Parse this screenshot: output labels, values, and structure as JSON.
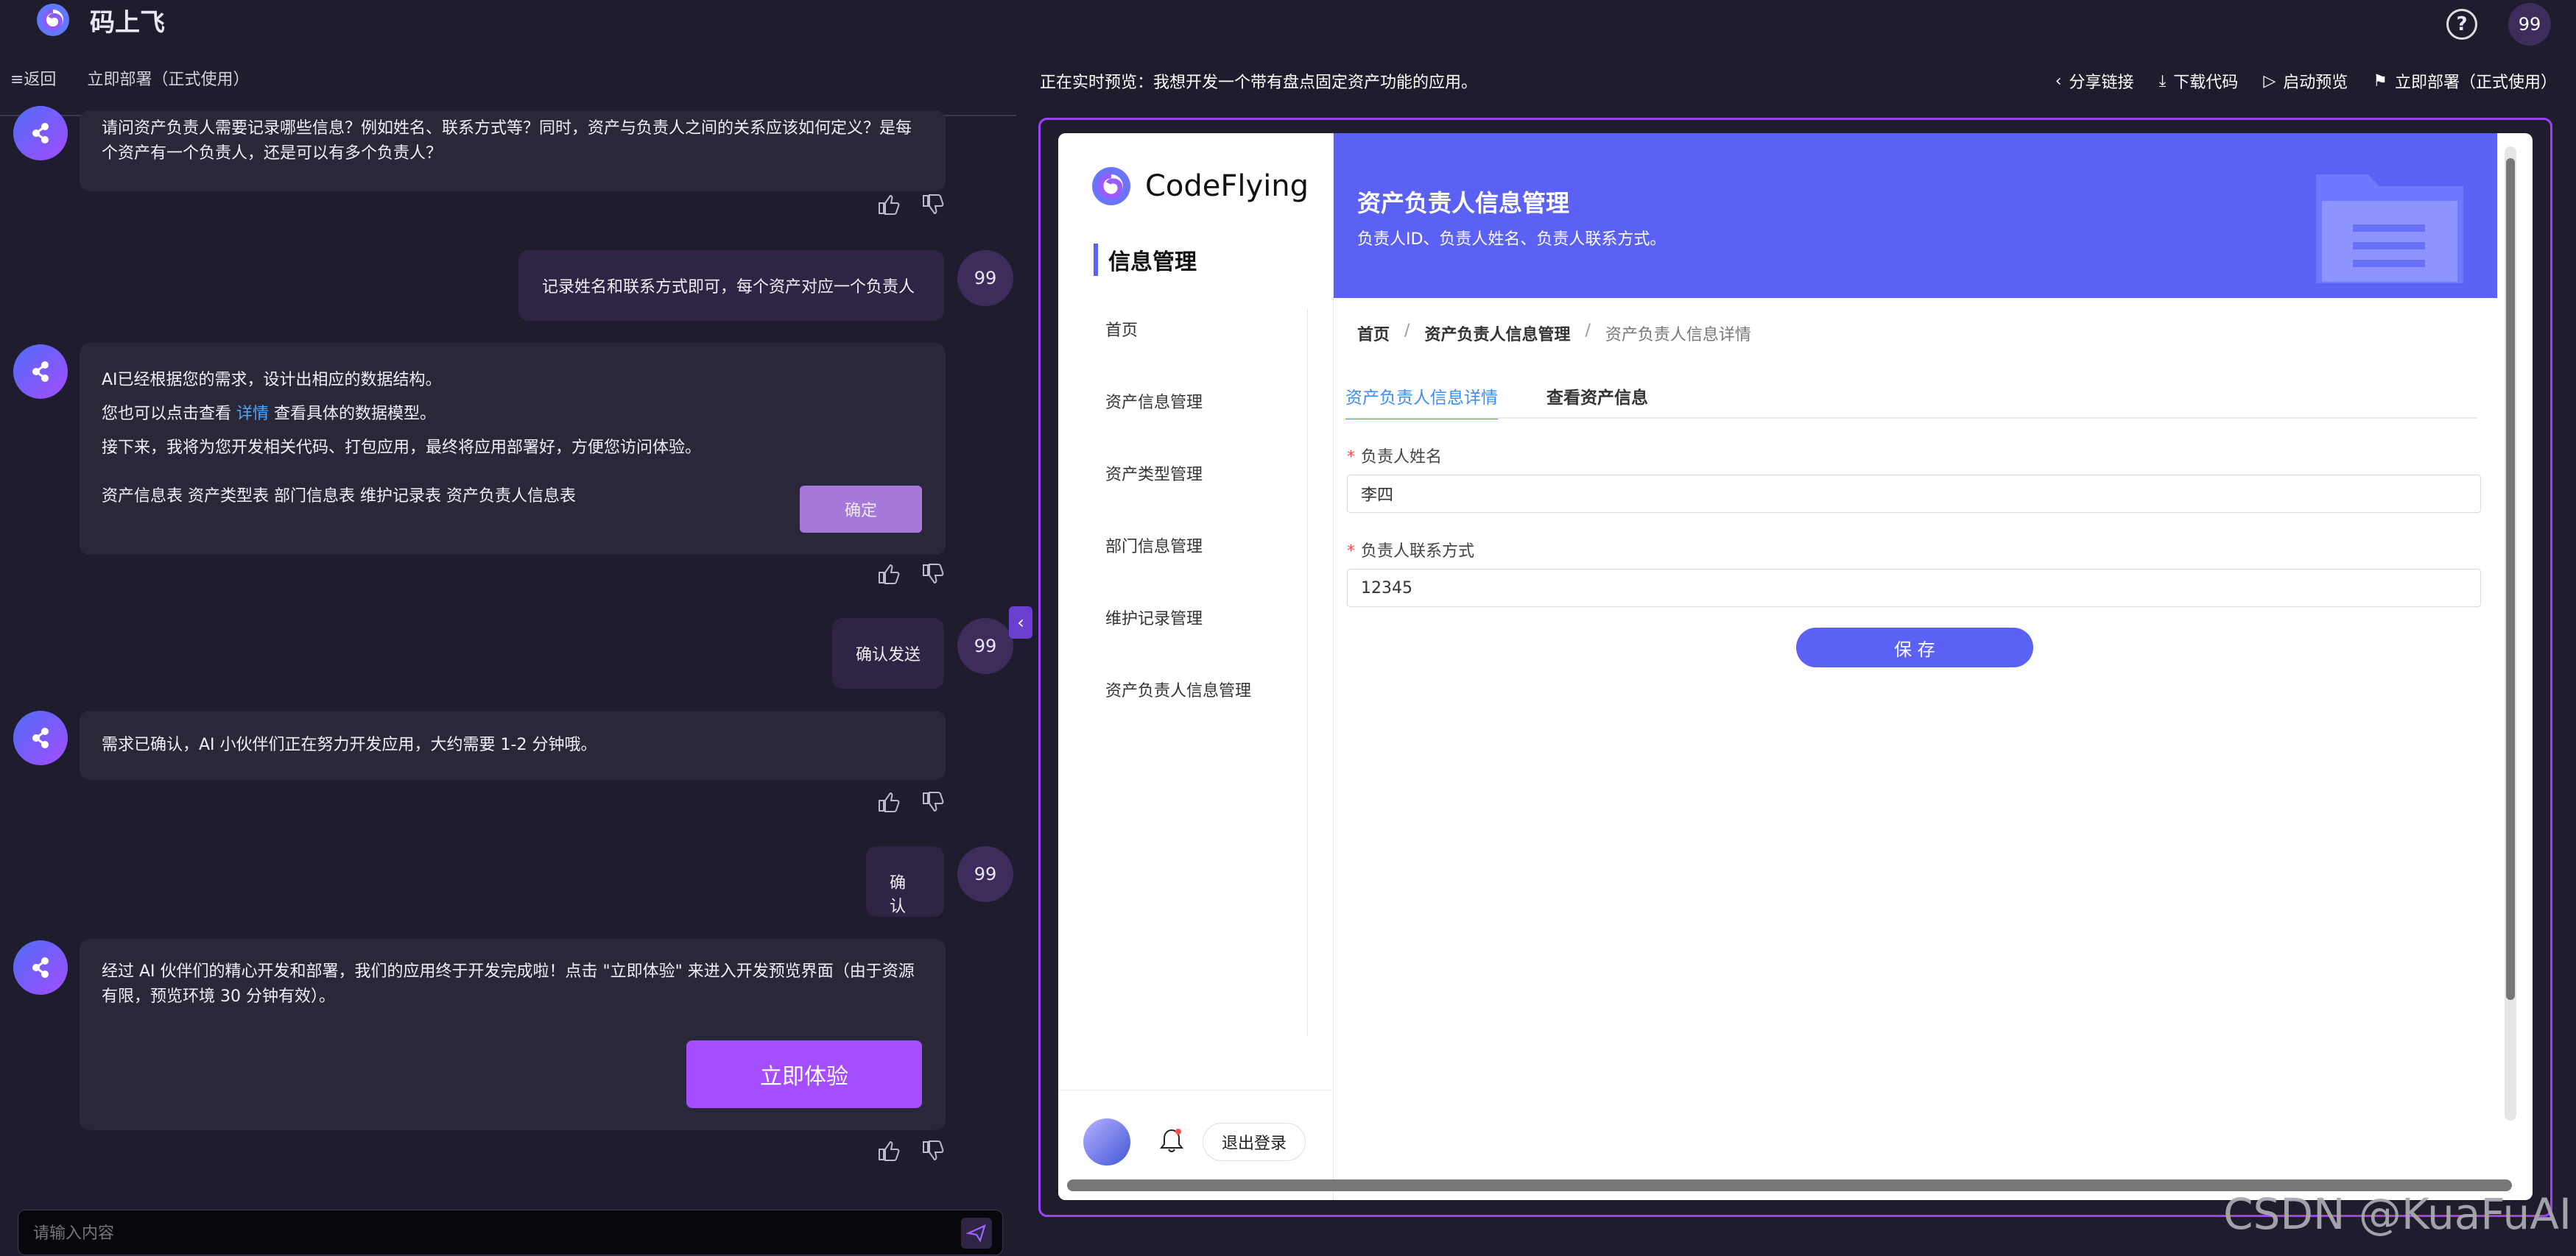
{
  "app": {
    "title": "码上飞",
    "avatar": "99",
    "help": "?"
  },
  "left_toolbar": {
    "back": "≡返回",
    "deploy": "立即部署（正式使用）"
  },
  "messages": [
    {
      "role": "bot",
      "text": "请问资产负责人需要记录哪些信息？例如姓名、联系方式等？同时，资产与负责人之间的关系应该如何定义？是每个资产有一个负责人，还是可以有多个负责人？"
    },
    {
      "role": "user",
      "text": "记录姓名和联系方式即可，每个资产对应一个负责人",
      "avatar": "99"
    },
    {
      "role": "bot",
      "lines": [
        "AI已经根据您的需求，设计出相应的数据结构。",
        "您也可以点击查看",
        "详情",
        "查看具体的数据模型。",
        "接下来，我将为您开发相关代码、打包应用，最终将应用部署好，方便您访问体验。",
        "资产信息表 资产类型表 部门信息表 维护记录表 资产负责人信息表"
      ],
      "button": "确定"
    },
    {
      "role": "user",
      "text": "确认发送",
      "avatar": "99"
    },
    {
      "role": "bot",
      "text": "需求已确认，AI 小伙伴们正在努力开发应用，大约需要 1-2 分钟哦。"
    },
    {
      "role": "user",
      "text": "确认",
      "avatar": "99"
    },
    {
      "role": "bot",
      "text": "经过 AI 伙伴们的精心开发和部署，我们的应用终于开发完成啦！点击 \"立即体验\" 来进入开发预览界面（由于资源有限，预览环境 30 分钟有效）。",
      "button": "立即体验"
    }
  ],
  "input": {
    "placeholder": "请输入内容"
  },
  "preview": {
    "status": "正在实时预览：我想开发一个带有盘点固定资产功能的应用。",
    "actions": [
      "分享链接",
      "下载代码",
      "启动预览",
      "立即部署（正式使用）"
    ],
    "brand": "CodeFlying",
    "section": "信息管理",
    "menu": [
      "首页",
      "资产信息管理",
      "资产类型管理",
      "部门信息管理",
      "维护记录管理",
      "资产负责人信息管理"
    ],
    "logout": "退出登录",
    "banner": {
      "title": "资产负责人信息管理",
      "subtitle": "负责人ID、负责人姓名、负责人联系方式。"
    },
    "breadcrumb": [
      "首页",
      "资产负责人信息管理",
      "资产负责人信息详情"
    ],
    "tabs": [
      "资产负责人信息详情",
      "查看资产信息"
    ],
    "fields": [
      {
        "label": "负责人姓名",
        "value": "李四"
      },
      {
        "label": "负责人联系方式",
        "value": "12345"
      }
    ],
    "save": "保 存"
  },
  "watermark": "CSDN @KuaFuAI",
  "colors": {
    "background": "#1f1d2d",
    "accent": "#a64dff",
    "preview_primary": "#5b61f5"
  }
}
